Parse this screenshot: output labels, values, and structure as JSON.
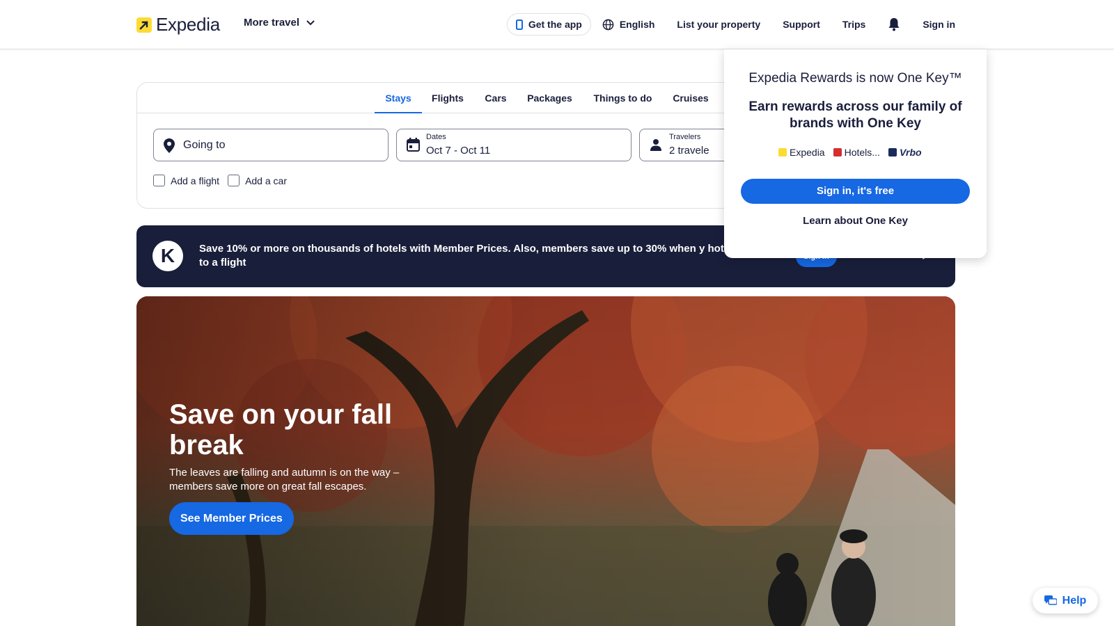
{
  "header": {
    "brand_name": "Expedia",
    "more_travel_label": "More travel",
    "get_app_label": "Get the app",
    "language_label": "English",
    "list_property_label": "List your property",
    "support_label": "Support",
    "trips_label": "Trips",
    "sign_in_label": "Sign in"
  },
  "search": {
    "tabs": [
      {
        "label": "Stays",
        "active": true
      },
      {
        "label": "Flights",
        "active": false
      },
      {
        "label": "Cars",
        "active": false
      },
      {
        "label": "Packages",
        "active": false
      },
      {
        "label": "Things to do",
        "active": false
      },
      {
        "label": "Cruises",
        "active": false
      }
    ],
    "going_to_placeholder": "Going to",
    "dates_label": "Dates",
    "dates_value": "Oct 7 - Oct 11",
    "travelers_label": "Travelers",
    "travelers_value": "2 travele",
    "add_flight_label": "Add a flight",
    "add_car_label": "Add a car"
  },
  "banner": {
    "logo_letter": "K",
    "text": "Save 10% or more on thousands of hotels with Member Prices. Also, members save up to 30% when y hotel to a flight",
    "sign_in_label": "Sign in",
    "learn_label": "Learn about One Key"
  },
  "hero": {
    "title": "Save on your fall break",
    "subtitle": "The leaves are falling and autumn is on the way – members save more on great fall escapes.",
    "button_label": "See Member Prices"
  },
  "popup": {
    "title": "Expedia Rewards is now One Key™",
    "subtitle": "Earn rewards across our family of brands with One Key",
    "brands": [
      {
        "name": "Expedia",
        "color": "#fddb32"
      },
      {
        "name": "Hotels...",
        "color": "#d32f2f"
      },
      {
        "name": "Vrbo",
        "color": "#1a2a5a"
      }
    ],
    "sign_in_button": "Sign in, it's free",
    "learn_link": "Learn about One Key"
  },
  "help": {
    "label": "Help"
  },
  "colors": {
    "primary": "#1668e3",
    "navy": "#191e3b",
    "brand_yellow": "#fddb32"
  }
}
